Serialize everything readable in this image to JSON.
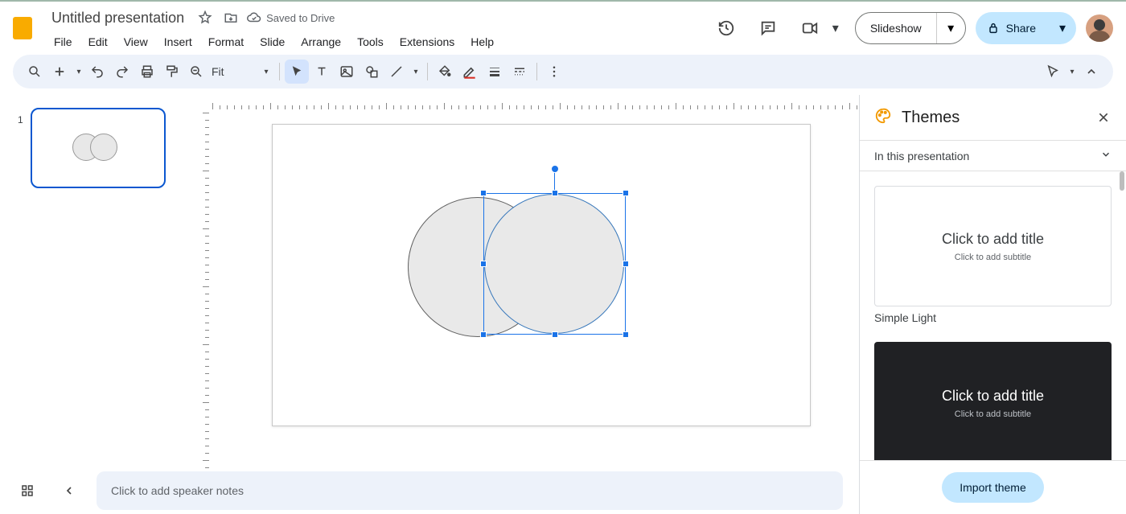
{
  "header": {
    "title": "Untitled presentation",
    "saved": "Saved to Drive",
    "menus": [
      "File",
      "Edit",
      "View",
      "Insert",
      "Format",
      "Slide",
      "Arrange",
      "Tools",
      "Extensions",
      "Help"
    ],
    "slideshow": "Slideshow",
    "share": "Share"
  },
  "toolbar": {
    "zoom": "Fit"
  },
  "filmstrip": {
    "slide1": "1"
  },
  "notes": {
    "placeholder": "Click to add speaker notes"
  },
  "themes": {
    "title": "Themes",
    "section": "In this presentation",
    "card_title": "Click to add title",
    "card_sub": "Click to add subtitle",
    "name1": "Simple Light",
    "import": "Import theme"
  }
}
